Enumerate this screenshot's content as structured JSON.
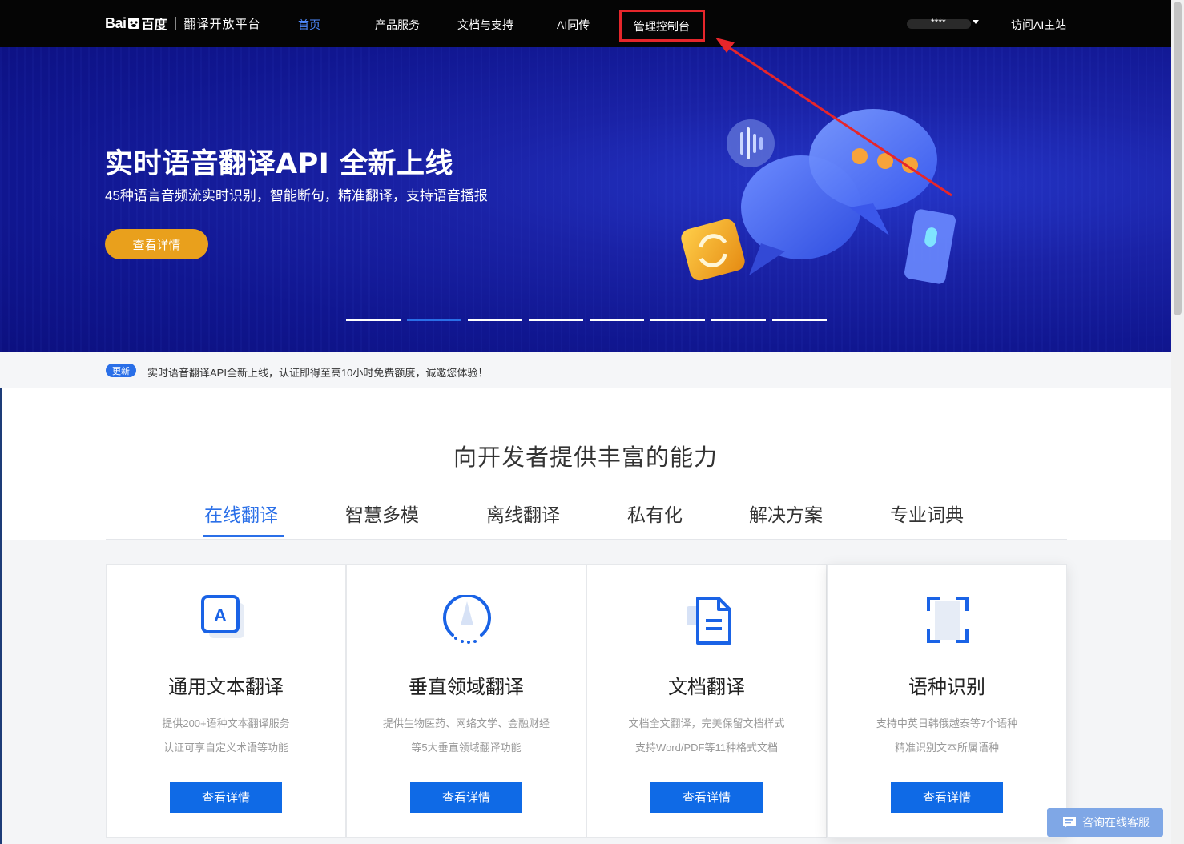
{
  "header": {
    "logo_bai": "Bai",
    "logo_cn": "百度",
    "platform_title": "翻译开放平台",
    "nav": [
      {
        "label": "首页",
        "active": true
      },
      {
        "label": "产品服务"
      },
      {
        "label": "文档与支持"
      },
      {
        "label": "AI同传"
      },
      {
        "label": "管理控制台",
        "highlighted": true
      }
    ],
    "user_name": "****",
    "visit_ai": "访问AI主站"
  },
  "banner": {
    "title": "实时语音翻译API 全新上线",
    "subtitle": "45种语言音频流实时识别，智能断句，精准翻译，支持语音播报",
    "button": "查看详情",
    "slide_count": 8,
    "active_slide": 2
  },
  "notice": {
    "badge": "更新",
    "text": "实时语音翻译API全新上线，认证即得至高10小时免费额度，诚邀您体验！"
  },
  "capabilities": {
    "title": "向开发者提供丰富的能力",
    "tabs": [
      "在线翻译",
      "智慧多模",
      "离线翻译",
      "私有化",
      "解决方案",
      "专业词典"
    ],
    "active_tab": 0
  },
  "cards": [
    {
      "icon": "text-translate-icon",
      "title": "通用文本翻译",
      "desc1": "提供200+语种文本翻译服务",
      "desc2": "认证可享自定义术语等功能",
      "button": "查看详情"
    },
    {
      "icon": "domain-translate-icon",
      "title": "垂直领域翻译",
      "desc1": "提供生物医药、网络文学、金融财经",
      "desc2": "等5大垂直领域翻译功能",
      "button": "查看详情"
    },
    {
      "icon": "document-translate-icon",
      "title": "文档翻译",
      "desc1": "文档全文翻译，完美保留文档样式",
      "desc2": "支持Word/PDF等11种格式文档",
      "button": "查看详情"
    },
    {
      "icon": "language-detect-icon",
      "title": "语种识别",
      "desc1": "支持中英日韩俄越泰等7个语种",
      "desc2": "精准识别文本所属语种",
      "button": "查看详情"
    }
  ],
  "chat": {
    "label": "咨询在线客服"
  },
  "colors": {
    "accent": "#0f6ae6",
    "banner_button": "#e9a01c",
    "annotation": "#e6262b"
  }
}
